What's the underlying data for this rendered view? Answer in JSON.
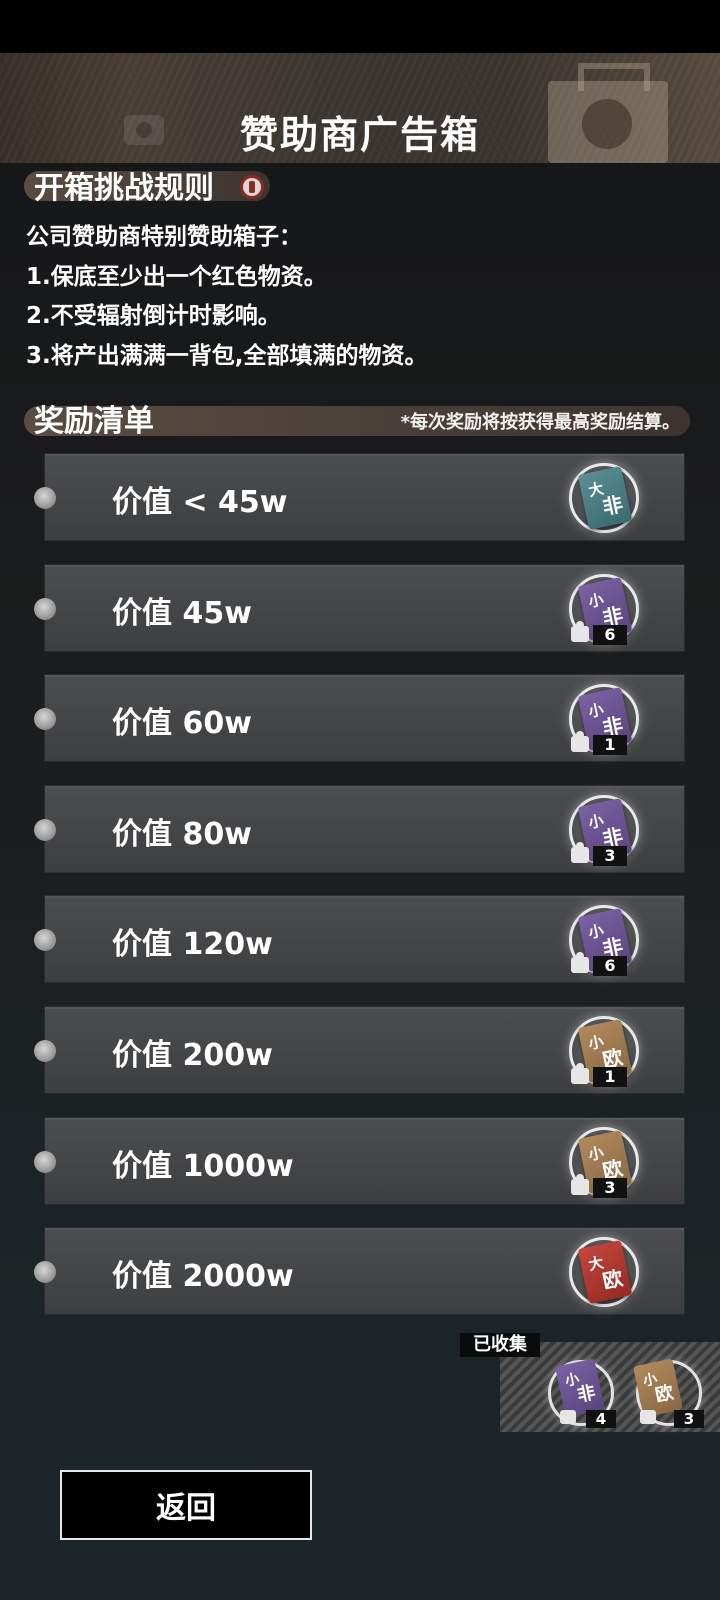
{
  "header": {
    "title": "赞助商广告箱"
  },
  "rules": {
    "title": "开箱挑战规则",
    "lines": [
      "公司赞助商特别赞助箱子：",
      "1.保底至少出一个红色物资。",
      "2.不受辐射倒计时影响。",
      "3.将产出满满一背包,全部填满的物资。"
    ]
  },
  "rewards": {
    "title": "奖励清单",
    "note": "*每次奖励将按获得最高奖励结算。",
    "tiers": [
      {
        "label": "价值 < 45w",
        "ticket_top": "大",
        "ticket_bottom": "非",
        "color": "teal",
        "count": ""
      },
      {
        "label": "价值 45w",
        "ticket_top": "小",
        "ticket_bottom": "非",
        "color": "purple",
        "count": "6"
      },
      {
        "label": "价值 60w",
        "ticket_top": "小",
        "ticket_bottom": "非",
        "color": "purple",
        "count": "1"
      },
      {
        "label": "价值 80w",
        "ticket_top": "小",
        "ticket_bottom": "非",
        "color": "purple",
        "count": "3"
      },
      {
        "label": "价值 120w",
        "ticket_top": "小",
        "ticket_bottom": "非",
        "color": "purple",
        "count": "6"
      },
      {
        "label": "价值 200w",
        "ticket_top": "小",
        "ticket_bottom": "欧",
        "color": "gold",
        "count": "1"
      },
      {
        "label": "价值 1000w",
        "ticket_top": "小",
        "ticket_bottom": "欧",
        "color": "gold",
        "count": "3"
      },
      {
        "label": "价值 2000w",
        "ticket_top": "大",
        "ticket_bottom": "欧",
        "color": "red",
        "count": ""
      }
    ]
  },
  "collected": {
    "label": "已收集",
    "items": [
      {
        "ticket_top": "小",
        "ticket_bottom": "非",
        "color": "purple",
        "count": "4"
      },
      {
        "ticket_top": "小",
        "ticket_bottom": "欧",
        "color": "gold",
        "count": "3"
      }
    ]
  },
  "footer": {
    "back_label": "返回"
  },
  "colors": {
    "accent_red": "#8f2a1e",
    "section_bar": "#5a4c42"
  },
  "icons": [
    "camera-icon",
    "briefcase-icon",
    "info-icon",
    "puzzle-icon"
  ]
}
